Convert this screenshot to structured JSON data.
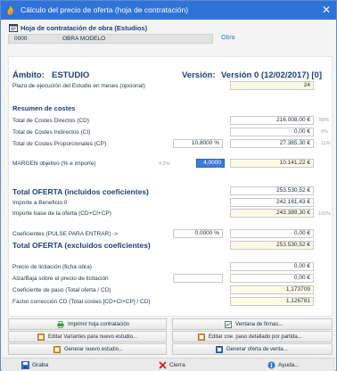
{
  "window": {
    "title": "Cálculo del precio de oferta (hoja de contratación)",
    "close": "✕"
  },
  "header": {
    "title": "Hoja de contratación de obra (Estudios)",
    "code": "0000",
    "name": "OBRA MODELO",
    "link": "Obra"
  },
  "ambito": {
    "label": "Ámbito:",
    "value": "ESTUDIO",
    "version_label": "Versión:",
    "version": "Versión 0 (12/02/2017) [0]"
  },
  "plazo": {
    "label": "Plazo de ejecución del Estudio en meses (opcional)",
    "value": "24"
  },
  "resumen": {
    "title": "Resumen de costes",
    "directos": {
      "label": "Total de Costes Directos (CD)",
      "value": "216.008,00 €",
      "pct": "89%"
    },
    "indirectos": {
      "label": "Total de Costes Indirectos (CI)",
      "value": "0,00 €",
      "pct": "0%"
    },
    "proporcionales": {
      "label": "Total de Costes Proporcionales (CP)",
      "pct_value": "10,8000 %",
      "value": "27.385,30 €",
      "pct": "11%"
    }
  },
  "margen": {
    "label": "MARGEN objetivo (% e importe)",
    "pct_side": "4,2%",
    "pct_value": "4,0000 %",
    "value": "10.141,22 €"
  },
  "total_oferta": {
    "label": "Total OFERTA (incluidos coeficientes)",
    "value": "253.530,52 €",
    "beneficio_label": "Importe a Beneficio 0",
    "beneficio_value": "242.161,43 €",
    "base_label": "Importe base de la oferta (CD+CI+CP)",
    "base_value": "243.389,30 €",
    "base_pct": "100%"
  },
  "coeficientes": {
    "label": "Coeficientes (PULSE PARA ENTRAR) ->",
    "pct_value": "0,0000 %",
    "value": "0,00 €"
  },
  "total_sin": {
    "label": "Total OFERTA (excluidos coeficientes)",
    "value": "253.530,52 €"
  },
  "licitacion": {
    "precio_label": "Precio de licitación (ficha obra)",
    "precio_value": "0,00 €",
    "alza_label": "Alza/Baja sobre el precio de licitación",
    "alza_value": "0,00 €",
    "coef_label": "Coeficiente de paso (Total oferta / CD)",
    "coef_value": "1,173709",
    "factor_label": "Factor corrección CD (Total costes [CD+CI+CP] / CD)",
    "factor_value": "1,126781"
  },
  "buttons": {
    "imprimir": "Imprimir hoja contratación",
    "firmas": "Ventana de firmas...",
    "variantes": "Editar Variantes para nuevo estudio...",
    "coe_paso": "Editar coe. paso detallado por partida...",
    "nuevo_estudio": "Generar nuevo estudio...",
    "oferta_venta": "Generar oferta de venta..."
  },
  "bottom": {
    "grabar": "Graba",
    "cierra": "Cierra",
    "ayuda": "Ayuda..."
  },
  "colors": {
    "titlebar": "#2f73d8",
    "accent": "#1d3f7a",
    "selection": "#3d7bd9"
  }
}
